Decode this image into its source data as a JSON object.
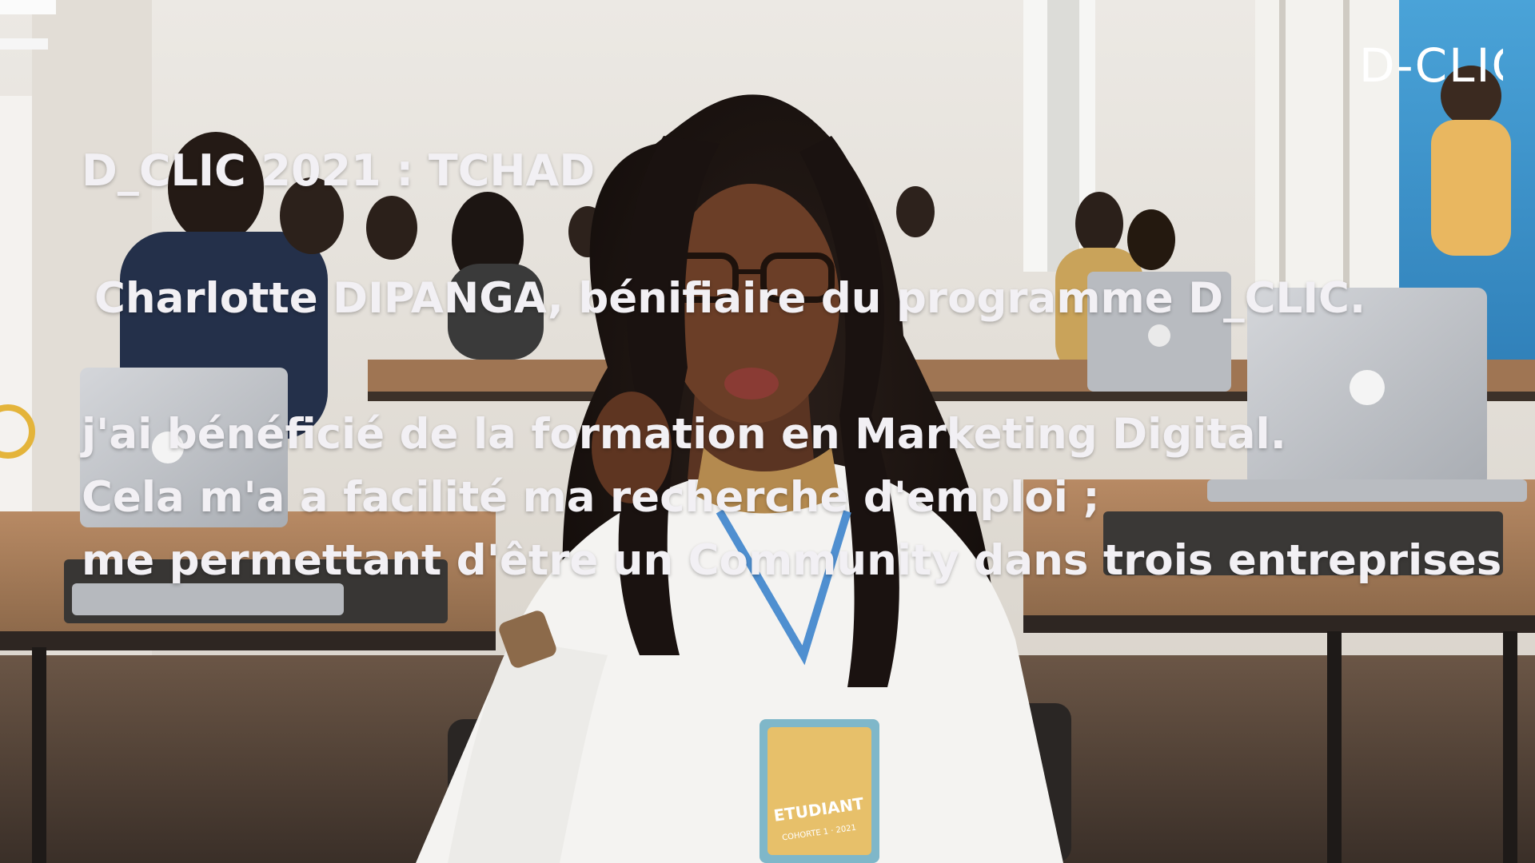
{
  "video": {
    "logo_text": "D-CLIC",
    "title": "D_CLIC 2021 : TCHAD",
    "subtitle": "Charlotte DIPANGA, bénifiaire du programme D_CLIC.",
    "quote_lines": [
      "j'ai bénéficié de la formation en Marketing Digital.",
      "Cela m'a a facilité ma recherche d'emploi ;",
      "me permettant d'être un Community dans trois entreprises"
    ],
    "badge_text": "ETUDIANT",
    "badge_subtext": "COHORTE 1 · 2021"
  },
  "colors": {
    "overlay_text": "#f2f0f4",
    "wall": "#e6e2dc",
    "desk": "#a87a55",
    "shirt": "#f4f3f1"
  }
}
